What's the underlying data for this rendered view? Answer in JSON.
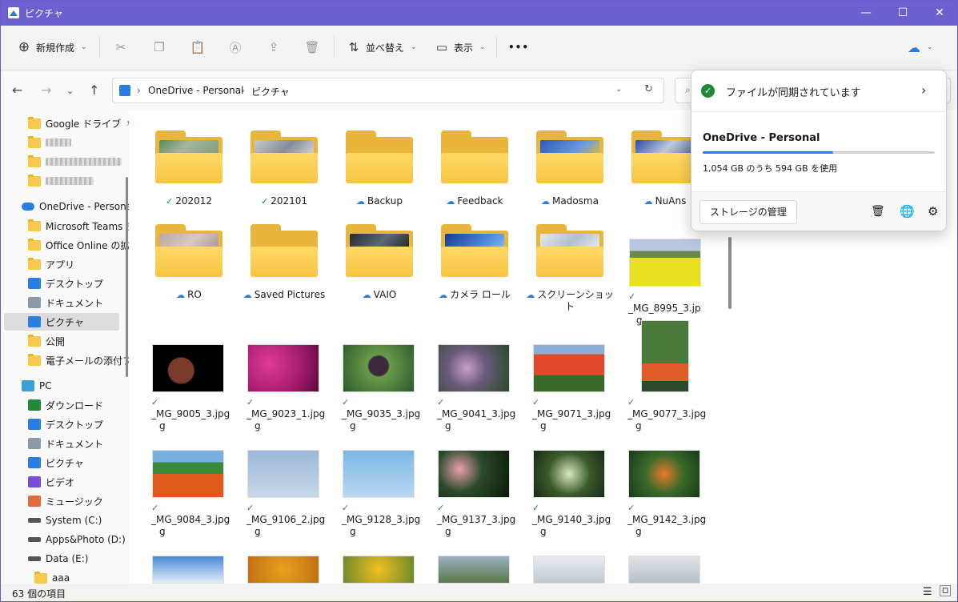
{
  "window": {
    "title": "ピクチャ",
    "controls": [
      "—",
      "☐",
      "✕"
    ]
  },
  "toolbar": {
    "new_label": "新規作成",
    "sort_label": "並べ替え",
    "view_label": "表示",
    "more_label": "•••"
  },
  "address": {
    "crumbs": [
      "OneDrive - Personal",
      "ピクチャ"
    ],
    "sep": "›"
  },
  "sidebar": {
    "items": [
      {
        "label": "Google ドライブ",
        "icon": "folder-icon",
        "pinned": true
      },
      {
        "label": "",
        "icon": "folder-icon",
        "blurred": true
      },
      {
        "label": "",
        "icon": "folder-icon",
        "blurred": true
      },
      {
        "label": "",
        "icon": "folder-icon",
        "blurred": true
      },
      {
        "label": "OneDrive - Persona",
        "icon": "cloud-icon"
      },
      {
        "label": "Microsoft Teams チ",
        "icon": "folder-icon"
      },
      {
        "label": "Office Online の拡",
        "icon": "folder-icon"
      },
      {
        "label": "アプリ",
        "icon": "folder-icon"
      },
      {
        "label": "デスクトップ",
        "icon": "desktop-icon"
      },
      {
        "label": "ドキュメント",
        "icon": "document-icon"
      },
      {
        "label": "ピクチャ",
        "icon": "pictures-icon",
        "selected": true
      },
      {
        "label": "公開",
        "icon": "folder-icon"
      },
      {
        "label": "電子メールの添付フ",
        "icon": "folder-icon"
      },
      {
        "label": "PC",
        "icon": "pc-icon"
      },
      {
        "label": "ダウンロード",
        "icon": "download-icon"
      },
      {
        "label": "デスクトップ",
        "icon": "desktop-icon"
      },
      {
        "label": "ドキュメント",
        "icon": "document-icon"
      },
      {
        "label": "ピクチャ",
        "icon": "pictures-icon"
      },
      {
        "label": "ビデオ",
        "icon": "video-icon"
      },
      {
        "label": "ミュージック",
        "icon": "music-icon"
      },
      {
        "label": "System (C:)",
        "icon": "drive-icon"
      },
      {
        "label": "Apps&Photo (D:)",
        "icon": "drive-icon"
      },
      {
        "label": "Data (E:)",
        "icon": "drive-icon"
      },
      {
        "label": "aaa",
        "icon": "folder-icon"
      }
    ]
  },
  "folders": [
    {
      "name": "202012",
      "status": "synced"
    },
    {
      "name": "202101",
      "status": "synced"
    },
    {
      "name": "Backup",
      "status": "cloud"
    },
    {
      "name": "Feedback",
      "status": "cloud"
    },
    {
      "name": "Madosma",
      "status": "cloud"
    },
    {
      "name": "NuAns",
      "status": "cloud"
    },
    {
      "name": "RO",
      "status": "cloud"
    },
    {
      "name": "Saved Pictures",
      "status": "cloud"
    },
    {
      "name": "VAIO",
      "status": "cloud"
    },
    {
      "name": "カメラ ロール",
      "status": "cloud"
    },
    {
      "name": "スクリーンショット",
      "status": "cloud"
    }
  ],
  "images": [
    {
      "name1": "_MG_8995_3.jp",
      "name2": "g"
    },
    {
      "name1": "_MG_9005_3.jpg",
      "name2": "g"
    },
    {
      "name1": "_MG_9023_1.jpg",
      "name2": "g"
    },
    {
      "name1": "_MG_9035_3.jpg",
      "name2": "g"
    },
    {
      "name1": "_MG_9041_3.jpg",
      "name2": "g"
    },
    {
      "name1": "_MG_9071_3.jpg",
      "name2": "g"
    },
    {
      "name1": "_MG_9077_3.jpg",
      "name2": "g"
    },
    {
      "name1": "_MG_9084_3.jpg",
      "name2": "g"
    },
    {
      "name1": "_MG_9106_2.jpg",
      "name2": "g"
    },
    {
      "name1": "_MG_9128_3.jpg",
      "name2": "g"
    },
    {
      "name1": "_MG_9137_3.jpg",
      "name2": "g"
    },
    {
      "name1": "_MG_9140_3.jpg",
      "name2": "g"
    },
    {
      "name1": "_MG_9142_3.jpg",
      "name2": "g"
    }
  ],
  "status": {
    "count": "63 個の項目"
  },
  "onedrive_popup": {
    "sync_status": "ファイルが同期されています",
    "account": "OneDrive - Personal",
    "usage_text": "1,054 GB のうち 594 GB を使用",
    "usage_fraction": 0.5636,
    "manage_button": "ストレージの管理"
  },
  "colors": {
    "titlebar": "#6c5fcf",
    "accent": "#2a7de1",
    "synced": "#1e8a3a",
    "folder": "#f7c542"
  }
}
